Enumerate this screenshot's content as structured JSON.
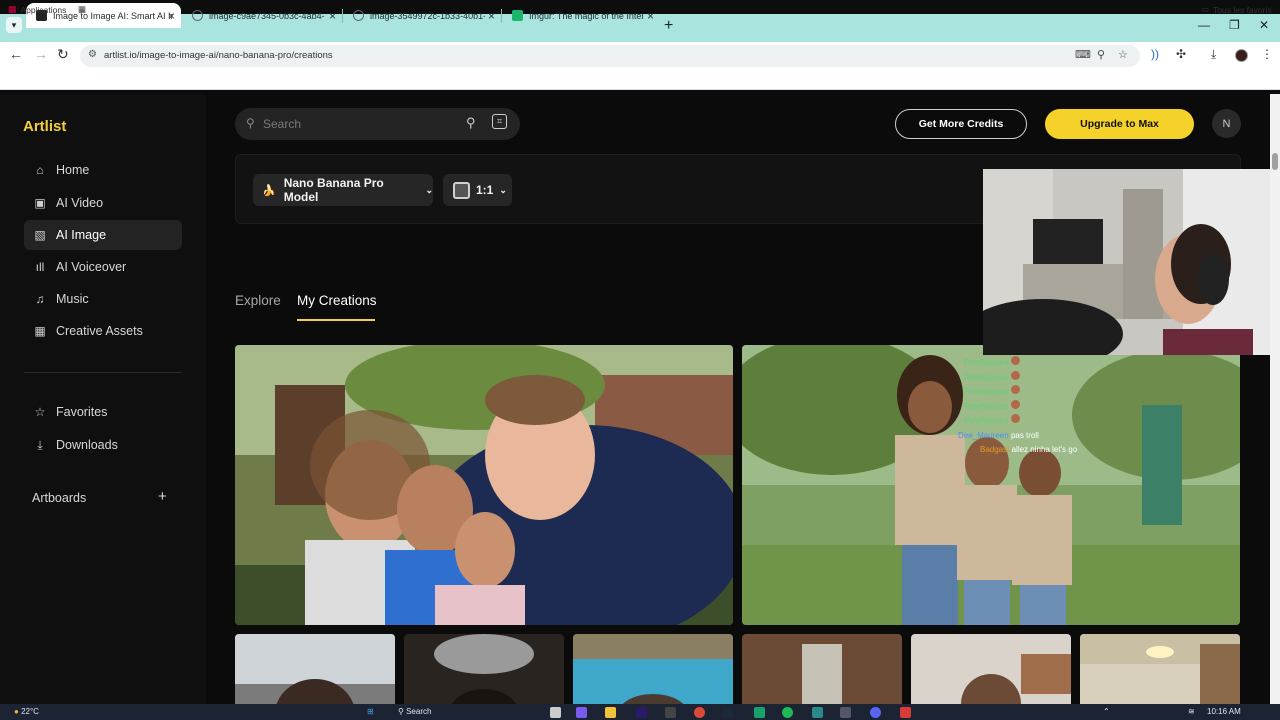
{
  "browser": {
    "tabs": [
      {
        "title": "Image to Image AI: Smart AI Im",
        "active": true
      },
      {
        "title": "image-c9ae7345-0b3c-4ab4-a7"
      },
      {
        "title": "image-3549972c-1b33-40b1-af"
      },
      {
        "title": "Imgur: The magic of the Interne"
      }
    ],
    "url": "artlist.io/image-to-image-ai/nano-banana-pro/creations",
    "bookmarks": {
      "apps": "Applications",
      "all": "Tous les favoris"
    }
  },
  "app": {
    "logo": "Artlist",
    "nav": [
      {
        "label": "Home",
        "icon": "home-icon"
      },
      {
        "label": "AI Video",
        "icon": "video-icon"
      },
      {
        "label": "AI Image",
        "icon": "image-icon",
        "active": true
      },
      {
        "label": "AI Voiceover",
        "icon": "waveform-icon"
      },
      {
        "label": "Music",
        "icon": "music-note-icon"
      },
      {
        "label": "Creative Assets",
        "icon": "grid-icon"
      }
    ],
    "nav2": [
      {
        "label": "Favorites",
        "icon": "star-icon"
      },
      {
        "label": "Downloads",
        "icon": "download-icon"
      }
    ],
    "artboards": "Artboards",
    "search_placeholder": "Search",
    "credits_btn": "Get More Credits",
    "upgrade_btn": "Upgrade to Max",
    "user_initial": "N",
    "model": "Nano Banana Pro Model",
    "ratio": "1:1",
    "tabs": {
      "explore": "Explore",
      "mine": "My Creations"
    }
  },
  "chat": [
    {
      "user": "PereNguyen",
      "msg": ""
    },
    {
      "user": "PereNguyen",
      "msg": ""
    },
    {
      "user": "PereNguyen",
      "msg": ""
    },
    {
      "user": "PereNguyen",
      "msg": ""
    },
    {
      "user": "PereNguyen",
      "msg": ""
    },
    {
      "user": "Dee_Maureen",
      "msg": "pas troll"
    },
    {
      "user": "Badgast",
      "msg": "allez ninha let's go"
    }
  ],
  "taskbar": {
    "weather": "22°C",
    "search": "Search",
    "time": "10:16 AM"
  },
  "colors": {
    "accent": "#f5d22a",
    "tabbar": "#a9e4de",
    "bg": "#0b0b0b"
  }
}
